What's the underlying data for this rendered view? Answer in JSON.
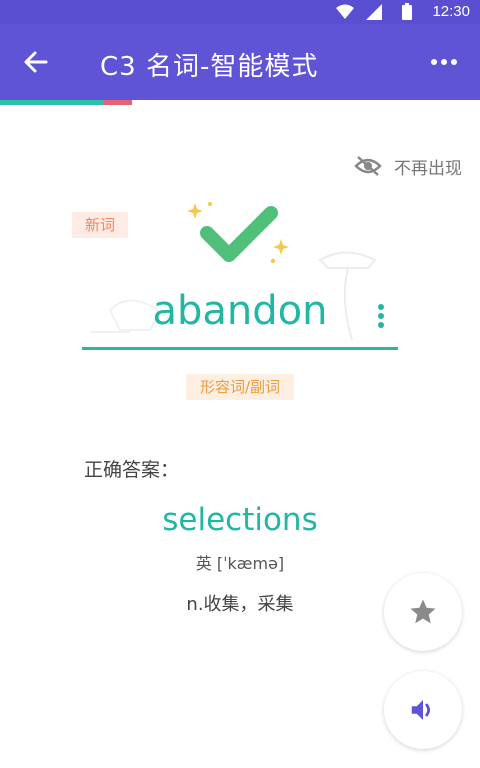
{
  "status_bar": {
    "time": "12:30"
  },
  "app_bar": {
    "title": "C3 名词-智能模式"
  },
  "progress": {
    "correct_fraction": 0.217,
    "wrong_fraction": 0.058
  },
  "hide_toggle": {
    "label": "不再出现"
  },
  "card": {
    "new_badge": "新词",
    "word": "abandon",
    "part_of_speech": "形容词/副词"
  },
  "answer": {
    "label": "正确答案：",
    "word": "selections",
    "phonetic": "英 [ˈkæmə]",
    "definition": "n.收集，采集"
  },
  "fabs": {
    "star": "star-icon",
    "sound": "speaker-icon"
  },
  "colors": {
    "primary": "#5f54d6",
    "accent": "#22b7a3",
    "error": "#e56472"
  }
}
